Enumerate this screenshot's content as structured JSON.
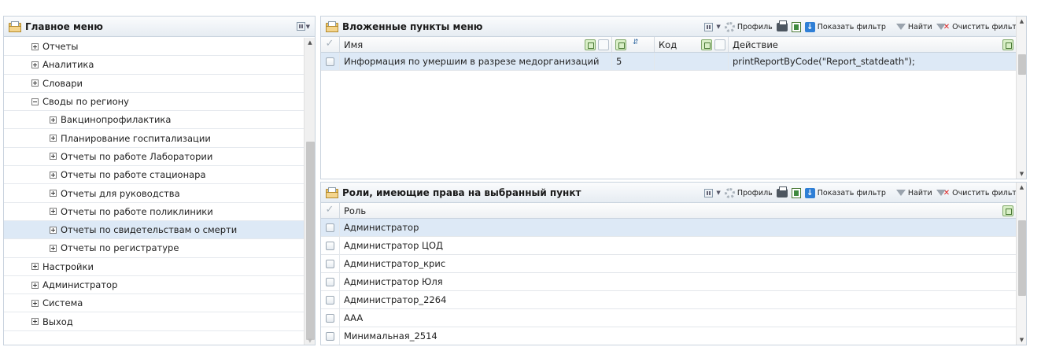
{
  "main_menu": {
    "title": "Главное меню",
    "items": [
      {
        "label": "Отчеты",
        "level": 1,
        "expander": "plus"
      },
      {
        "label": "Аналитика",
        "level": 1,
        "expander": "plus"
      },
      {
        "label": "Словари",
        "level": 1,
        "expander": "plus"
      },
      {
        "label": "Своды по региону",
        "level": 1,
        "expander": "minus"
      },
      {
        "label": "Вакцинопрофилактика",
        "level": 2,
        "expander": "plus"
      },
      {
        "label": "Планирование госпитализации",
        "level": 2,
        "expander": "plus"
      },
      {
        "label": "Отчеты по работе Лаборатории",
        "level": 2,
        "expander": "plus"
      },
      {
        "label": "Отчеты по работе стационара",
        "level": 2,
        "expander": "plus"
      },
      {
        "label": "Отчеты для руководства",
        "level": 2,
        "expander": "plus"
      },
      {
        "label": "Отчеты по работе поликлиники",
        "level": 2,
        "expander": "plus"
      },
      {
        "label": "Отчеты по свидетельствам о смерти",
        "level": 2,
        "expander": "plus",
        "selected": true
      },
      {
        "label": "Отчеты по регистратуре",
        "level": 2,
        "expander": "plus"
      },
      {
        "label": "Настройки",
        "level": 1,
        "expander": "plus"
      },
      {
        "label": "Администратор",
        "level": 1,
        "expander": "plus"
      },
      {
        "label": "Система",
        "level": 1,
        "expander": "plus"
      },
      {
        "label": "Выход",
        "level": 1,
        "expander": "plus"
      }
    ]
  },
  "toolbar": {
    "profile": "Профиль",
    "show_filter": "Показать фильтр",
    "find": "Найти",
    "clear_filter": "Очистить фильтр"
  },
  "nested_items": {
    "title": "Вложенные пункты меню",
    "columns": {
      "name": "Имя",
      "code": "Код",
      "action": "Действие"
    },
    "rows": [
      {
        "name": "Информация по умершим в разрезе медорганизаций",
        "order": "5",
        "code": "",
        "action": "printReportByCode(\"Report_statdeath\");"
      }
    ]
  },
  "roles": {
    "title": "Роли, имеющие права на выбранный пункт",
    "column": "Роль",
    "rows": [
      "Администратор",
      "Администратор ЦОД",
      "Администратор_крис",
      "Администратор Юля",
      "Администратор_2264",
      "AAA",
      "Минимальная_2514"
    ]
  },
  "colors": {
    "selected_row": "#dde9f6",
    "panel_border": "#c9d3de"
  }
}
